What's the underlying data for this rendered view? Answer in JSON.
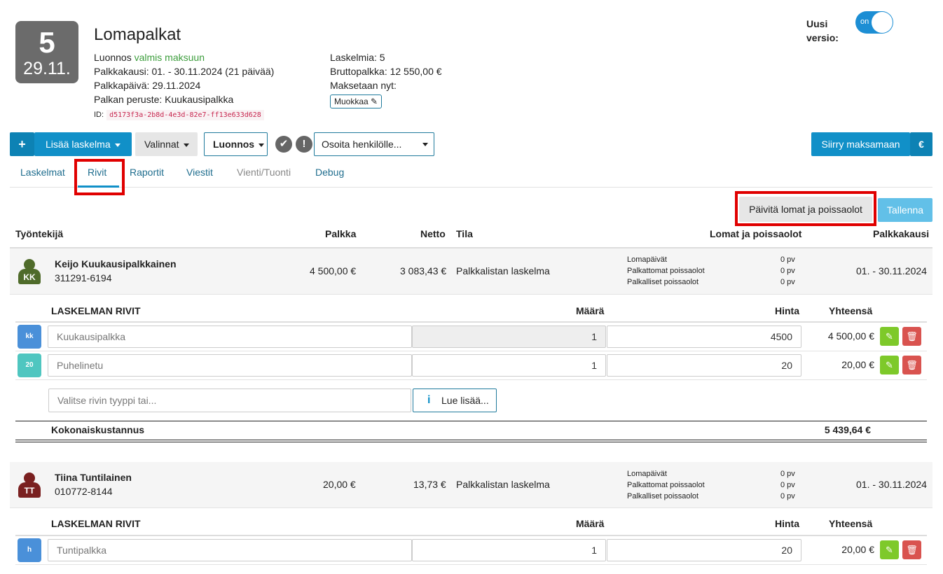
{
  "header": {
    "day": "5",
    "date": "29.11.",
    "title": "Lomapalkat",
    "status_prefix": "Luonnos",
    "status_green": "valmis maksuun",
    "period": "Palkkakausi: 01. - 30.11.2024 (21 päivää)",
    "payday": "Palkkapäivä: 29.11.2024",
    "basis": "Palkan peruste: Kuukausipalkka",
    "id_label": "ID:",
    "id_value": "d5173f3a-2b8d-4e3d-82e7-ff13e633d628",
    "calc_count": "Laskelmia: 5",
    "gross": "Bruttopalkka: 12 550,00 €",
    "pay_now": "Maksetaan nyt:",
    "edit_label": "Muokkaa"
  },
  "version": {
    "label_1": "Uusi",
    "label_2": "versio:",
    "toggle": "on"
  },
  "toolbar": {
    "add_plus": "+",
    "add_label": "Lisää laskelma",
    "options_label": "Valinnat",
    "draft_label": "Luonnos",
    "check_icon": "✔",
    "warn_icon": "!",
    "assign_label": "Osoita henkilölle...",
    "goto_pay_label": "Siirry maksamaan",
    "euro_label": "€"
  },
  "tabs": [
    "Laskelmat",
    "Rivit",
    "Raportit",
    "Viestit",
    "Vienti/Tuonti",
    "Debug"
  ],
  "actions": {
    "update_label": "Päivitä lomat ja poissaolot",
    "save_label": "Tallenna"
  },
  "table_headers": {
    "employee": "Työntekijä",
    "salary": "Palkka",
    "net": "Netto",
    "state": "Tila",
    "absences": "Lomat ja poissaolot",
    "period": "Palkkakausi"
  },
  "rows_headers": {
    "title": "LASKELMAN RIVIT",
    "qty": "Määrä",
    "price": "Hinta",
    "total": "Yhteensä"
  },
  "absence_labels": [
    "Lomapäivät",
    "Palkattomat poissaolot",
    "Palkalliset poissaolot"
  ],
  "employees": [
    {
      "initials": "KK",
      "name": "Keijo Kuukausipalkkainen",
      "ssn": "311291-6194",
      "salary": "4 500,00 €",
      "net": "3 083,43 €",
      "state": "Palkkalistan laskelma",
      "absences": [
        "0 pv",
        "0 pv",
        "0 pv"
      ],
      "period": "01. - 30.11.2024",
      "rows": [
        {
          "badge": "kk",
          "name": "Kuukausipalkka",
          "qty": "1",
          "price": "4500",
          "total": "4 500,00 €"
        },
        {
          "badge": "20",
          "name": "Puhelinetu",
          "qty": "1",
          "price": "20",
          "total": "20,00 €"
        }
      ],
      "row_type_placeholder": "Valitse rivin tyyppi tai...",
      "read_more": "Lue lisää...",
      "cost_label": "Kokonaiskustannus",
      "cost_value": "5 439,64 €"
    },
    {
      "initials": "TT",
      "name": "Tiina Tuntilainen",
      "ssn": "010772-8144",
      "salary": "20,00 €",
      "net": "13,73 €",
      "state": "Palkkalistan laskelma",
      "absences": [
        "0 pv",
        "0 pv",
        "0 pv"
      ],
      "period": "01. - 30.11.2024",
      "rows": [
        {
          "badge": "h",
          "name": "Tuntipalkka",
          "qty": "1",
          "price": "20",
          "total": "20,00 €"
        }
      ]
    }
  ],
  "colors": {
    "primary": "#1190c8",
    "highlight": "#e00000",
    "avatar_green": "#4f6b2a",
    "avatar_red": "#7a2020",
    "badge_blue": "#4a90d9",
    "badge_teal": "#4fc6c0"
  },
  "icons": {
    "pencil": "✎",
    "trash": "🗑",
    "info": "i"
  }
}
